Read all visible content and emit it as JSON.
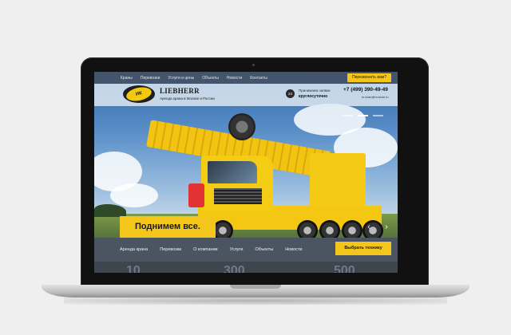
{
  "topnav": {
    "links": [
      "Краны",
      "Перевозки",
      "Услуги и цены",
      "Объекты",
      "Новости",
      "Контакты"
    ],
    "callback_label": "Перезвонить вам?"
  },
  "header": {
    "logo_text": "ИК",
    "brand": "LIEBHERR",
    "tagline": "Аренда крана в Москве и России",
    "badge": "24",
    "orders_line1": "Принимаем заявки",
    "orders_line2": "круглосуточно",
    "phone": "+7 (499) 390-49-49",
    "email": "m-kran@m-kran.ru"
  },
  "hero": {
    "slogan": "Поднимем все.",
    "slider_index": 1,
    "slider_count": 3
  },
  "bottomnav": {
    "links": [
      "Аренда крана",
      "Перевозки",
      "О компании",
      "Услуги",
      "Объекты",
      "Новости"
    ],
    "pick_label": "Выбрать технику"
  },
  "stats": [
    "10",
    "300",
    "500"
  ],
  "icons": {
    "prev": "chevron-left-icon",
    "next": "chevron-right-icon"
  },
  "colors": {
    "accent": "#f4c51a",
    "nav_bg": "#4b5561"
  }
}
